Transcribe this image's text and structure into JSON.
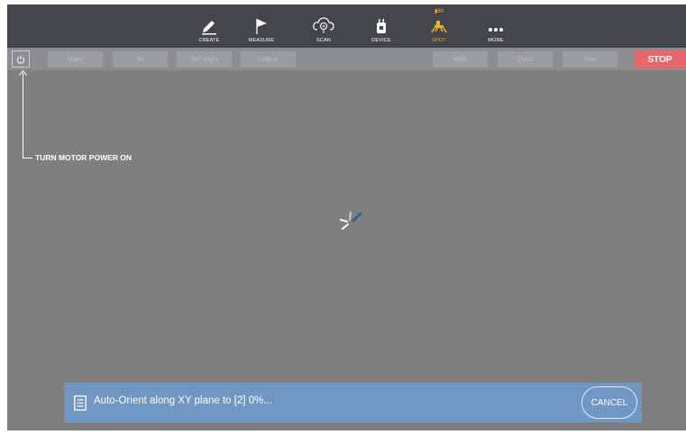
{
  "nav": {
    "items": [
      {
        "label": "CREATE",
        "icon": "pencil-icon"
      },
      {
        "label": "MEASURE",
        "icon": "flag-icon"
      },
      {
        "label": "SCAN",
        "icon": "cloud-scan-icon"
      },
      {
        "label": "DEVICE",
        "icon": "device-icon"
      },
      {
        "label": "SPOT",
        "icon": "robot-spot-icon",
        "badge": "80"
      },
      {
        "label": "MORE",
        "icon": "more-dots-icon"
      }
    ],
    "active": "SPOT",
    "active_color": "#f2b21b"
  },
  "controls": {
    "power_icon": "power-icon",
    "buttons": [
      "Stand",
      "Sit",
      "Self Right",
      "Unlock",
      "Walk",
      "Crawl",
      "Stair"
    ],
    "stop_label": "STOP",
    "stop_color": "#e8676d"
  },
  "annotation": {
    "text": "TURN MOTOR POWER ON"
  },
  "status": {
    "message": "Auto-Orient along XY plane to [2] 0%...",
    "cancel_label": "CANCEL",
    "bar_color": "#7096c4"
  }
}
